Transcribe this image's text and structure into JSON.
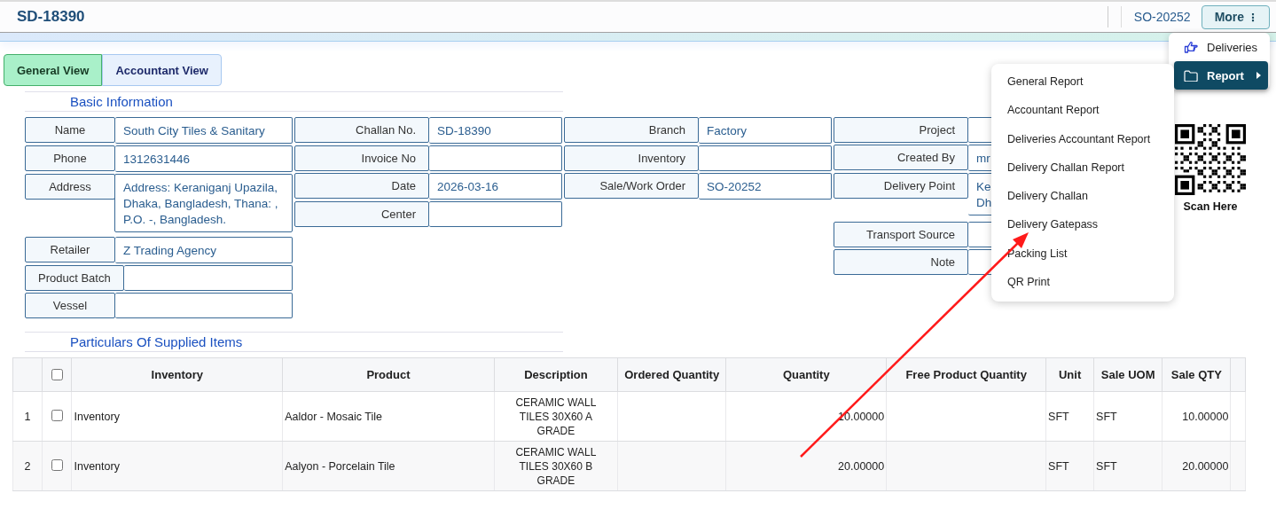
{
  "header": {
    "title": "SD-18390",
    "order_ref": "SO-20252",
    "more_button": {
      "label": "More",
      "icon": "⋮"
    }
  },
  "tabs": [
    {
      "label": "General View",
      "selected": true
    },
    {
      "label": "Accountant View",
      "selected": false
    }
  ],
  "basic_information": {
    "title": "Basic Information",
    "columns": [
      [
        {
          "label": "Name",
          "value": "South City Tiles & Sanitary"
        },
        {
          "label": "Phone",
          "value": "1312631446"
        },
        {
          "label": "Address",
          "value": "Address: Keraniganj Upazila, Dhaka, Bangladesh, Thana: , P.O. -, Bangladesh."
        },
        {
          "label": "Retailer",
          "value": "Z Trading Agency"
        },
        {
          "label": "Product Batch"
        },
        {
          "label": "Vessel"
        }
      ],
      [
        {
          "label": "Challan No.",
          "value": "SD-18390"
        },
        {
          "label": "Invoice No"
        },
        {
          "label": "Date",
          "value": "2026-03-16"
        },
        {
          "label": "Center"
        }
      ],
      [
        {
          "label": "Branch",
          "value": "Factory"
        },
        {
          "label": "Inventory"
        },
        {
          "label": "Sale/Work Order",
          "value": "SO-20252"
        }
      ],
      [
        {
          "label": "Project"
        },
        {
          "label": "Created By",
          "value": "mr"
        },
        {
          "label": "Delivery Point",
          "value": "Ke\nDh"
        },
        {
          "label": "Transport Source"
        },
        {
          "label": "Note"
        }
      ]
    ],
    "qr": {
      "caption": "Scan Here"
    }
  },
  "particulars": {
    "title": "Particulars Of Supplied Items",
    "columns": [
      "Inventory",
      "Product",
      "Description",
      "Ordered Quantity",
      "Quantity",
      "Free Product Quantity",
      "Unit",
      "Sale UOM",
      "Sale QTY"
    ],
    "header_checked": false,
    "rows": [
      {
        "index": "1",
        "checked": false,
        "cells": [
          "Inventory",
          "Aaldor - Mosaic Tile",
          "CERAMIC WALL TILES 30X60 A GRADE",
          "",
          "10.00000",
          "",
          "SFT",
          "SFT",
          "10.00000"
        ]
      },
      {
        "index": "2",
        "checked": false,
        "cells": [
          "Inventory",
          "Aalyon - Porcelain Tile",
          "CERAMIC WALL TILES 30X60 B GRADE",
          "",
          "20.00000",
          "",
          "SFT",
          "SFT",
          "20.00000"
        ]
      }
    ]
  },
  "more_menu": {
    "items": [
      {
        "label": "Deliveries",
        "kind": "action",
        "selected": false,
        "submenu": false
      },
      {
        "label": "Report",
        "kind": "folder",
        "selected": true,
        "submenu": true
      }
    ]
  },
  "report_submenu": {
    "items": [
      "General Report",
      "Accountant Report",
      "Deliveries Accountant Report",
      "Delivery Challan Report",
      "Delivery Challan",
      "Delivery Gatepass",
      "Packing List",
      "QR Print"
    ]
  }
}
